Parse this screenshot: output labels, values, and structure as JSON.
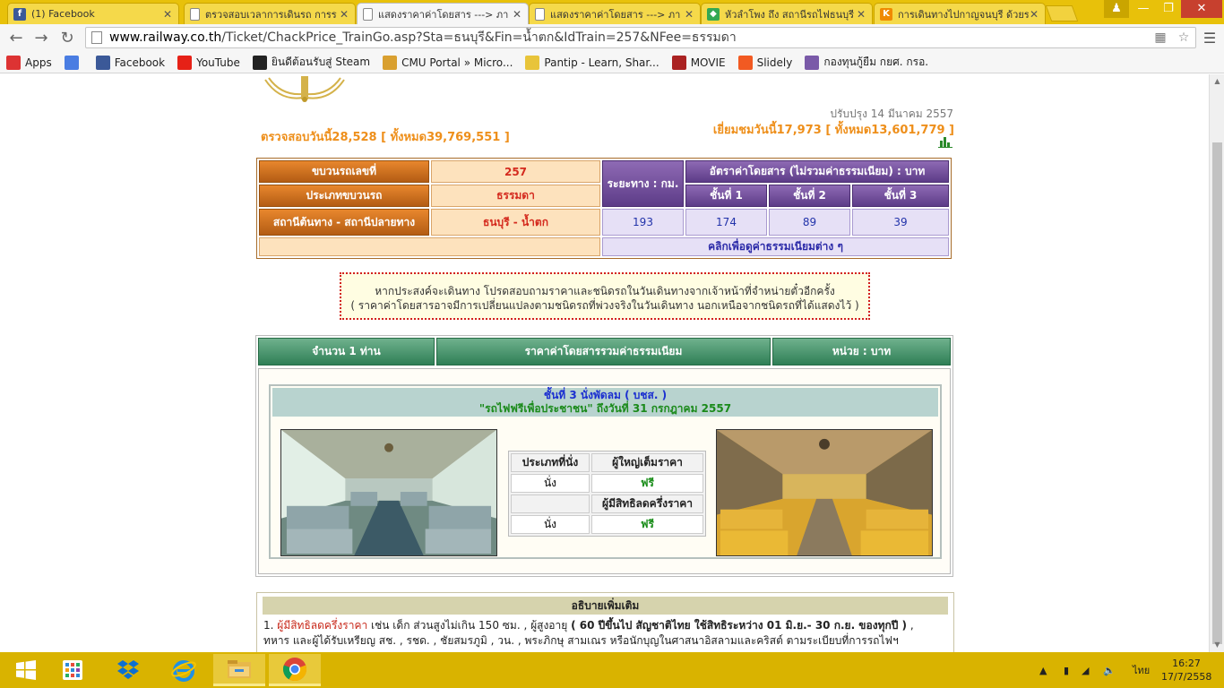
{
  "browser": {
    "tabs": [
      {
        "title": "(1) Facebook",
        "icon": "facebook-icon",
        "color": "#3b5998",
        "glyph": "f"
      },
      {
        "title": "ตรวจสอบเวลาการเดินรถ การร",
        "icon": "page-icon",
        "color": "",
        "glyph": ""
      },
      {
        "title": "แสดงราคาค่าโดยสาร ---> ภา",
        "icon": "page-icon",
        "color": "",
        "glyph": ""
      },
      {
        "title": "แสดงราคาค่าโดยสาร ---> ภา",
        "icon": "page-icon",
        "color": "",
        "glyph": ""
      },
      {
        "title": "หัวลำโพง ถึง สถานีรถไฟธนบุรี",
        "icon": "maps-icon",
        "color": "#34a853",
        "glyph": "◆"
      },
      {
        "title": "การเดินทางไปกาญจนบุรี ด้วยร",
        "icon": "k-icon",
        "color": "#f08a00",
        "glyph": "K"
      }
    ],
    "active_tab": 2,
    "url_host": "www.railway.co.th",
    "url_path": "/Ticket/ChackPrice_TrainGo.asp?Sta=ธนบุรี&Fin=น้ำตก&IdTrain=257&NFee=ธรรมดา",
    "bookmarks": [
      {
        "label": "Apps",
        "icon": "apps-icon",
        "color": "#d33"
      },
      {
        "label": "",
        "icon": "google-plus-icon",
        "color": "#4a7de2"
      },
      {
        "label": "Facebook",
        "icon": "facebook-icon",
        "color": "#3b5998"
      },
      {
        "label": "YouTube",
        "icon": "youtube-icon",
        "color": "#e62117"
      },
      {
        "label": "ยินดีต้อนรับสู่ Steam",
        "icon": "steam-icon",
        "color": "#222"
      },
      {
        "label": "CMU Portal » Micro...",
        "icon": "cmu-icon",
        "color": "#d9a030"
      },
      {
        "label": "Pantip - Learn, Shar...",
        "icon": "pantip-icon",
        "color": "#e8c43a"
      },
      {
        "label": "MOVIE",
        "icon": "movie-icon",
        "color": "#a22"
      },
      {
        "label": "Slidely",
        "icon": "slidely-icon",
        "color": "#f25a22"
      },
      {
        "label": "กองทุนกู้ยืม กยศ. กรอ.",
        "icon": "fund-icon",
        "color": "#7a5aa8"
      }
    ]
  },
  "page": {
    "updated": "ปรับปรุง 14 มีนาคม 2557",
    "stat_left": "ตรวจสอบวันนี้28,528 [ ทั้งหมด39,769,551 ]",
    "stat_right": "เยี่ยมชมวันนี้17,973 [ ทั้งหมด13,601,779 ]",
    "fare": {
      "train_no_label": "ขบวนรถเลขที่",
      "train_no": "257",
      "train_type_label": "ประเภทขบวนรถ",
      "train_type": "ธรรมดา",
      "route_label": "สถานีต้นทาง - สถานีปลายทาง",
      "route": "ธนบุรี - น้ำตก",
      "distance_label": "ระยะทาง : กม.",
      "distance": "193",
      "rate_label": "อัตราค่าโดยสาร (ไม่รวมค่าธรรมเนียม) : บาท",
      "class1_label": "ชั้นที่ 1",
      "class2_label": "ชั้นที่ 2",
      "class3_label": "ชั้นที่ 3",
      "class1": "174",
      "class2": "89",
      "class3": "39",
      "fee_link": "คลิกเพื่อดูค่าธรรมเนียมต่าง ๆ"
    },
    "notice": {
      "line1": "หากประสงค์จะเดินทาง โปรดสอบถามราคาและชนิดรถในวันเดินทางจากเจ้าหน้าที่จำหน่ายตั๋วอีกครั้ง",
      "line2": "( ราคาค่าโดยสารอาจมีการเปลี่ยนแปลงตามชนิดรถที่พ่วงจริงในวันเดินทาง นอกเหนือจากชนิดรถที่ได้แสดงไว้ )"
    },
    "class_header": {
      "count": "จำนวน 1 ท่าน",
      "fare": "ราคาค่าโดยสารรวมค่าธรรมเนียม",
      "unit": "หน่วย : บาท"
    },
    "seat": {
      "title": "ชั้นที่ 3 นั่งพัดลม ( บชส. )",
      "subtitle": "\"รถไฟฟรีเพื่อประชาชน\" ถึงวันที่ 31 กรกฎาคม 2557",
      "col_type": "ประเภทที่นั่ง",
      "col_adult": "ผู้ใหญ่เต็มราคา",
      "row1_type": "นั่ง",
      "row1_price": "ฟรี",
      "col_half": "ผู้มีสิทธิลดครึ่งราคา",
      "row2_type": "นั่ง",
      "row2_price": "ฟรี"
    },
    "info": {
      "title": "อธิบายเพิ่มเติม",
      "num": "1.",
      "red": "ผู้มีสิทธิลดครึ่งราคา",
      "text1": " เช่น เด็ก ส่วนสูงไม่เกิน 150 ซม. , ผู้สูงอายุ ",
      "bold": "( 60 ปีขึ้นไป สัญชาติไทย ใช้สิทธิระหว่าง 01 มิ.ย.- 30 ก.ย. ของทุกปี )",
      "text2": " ,",
      "line2": "ทหาร และผู้ได้รับเหรียญ สช. , รชด. , ชัยสมรภูมิ , วน. , พระภิกษุ สามเณร หรือนักบุญในศาสนาอิสลามและคริสต์ ตามระเบียบที่การรถไฟฯ"
    }
  },
  "taskbar": {
    "lang": "ไทย",
    "time": "16:27",
    "date": "17/7/2558"
  }
}
